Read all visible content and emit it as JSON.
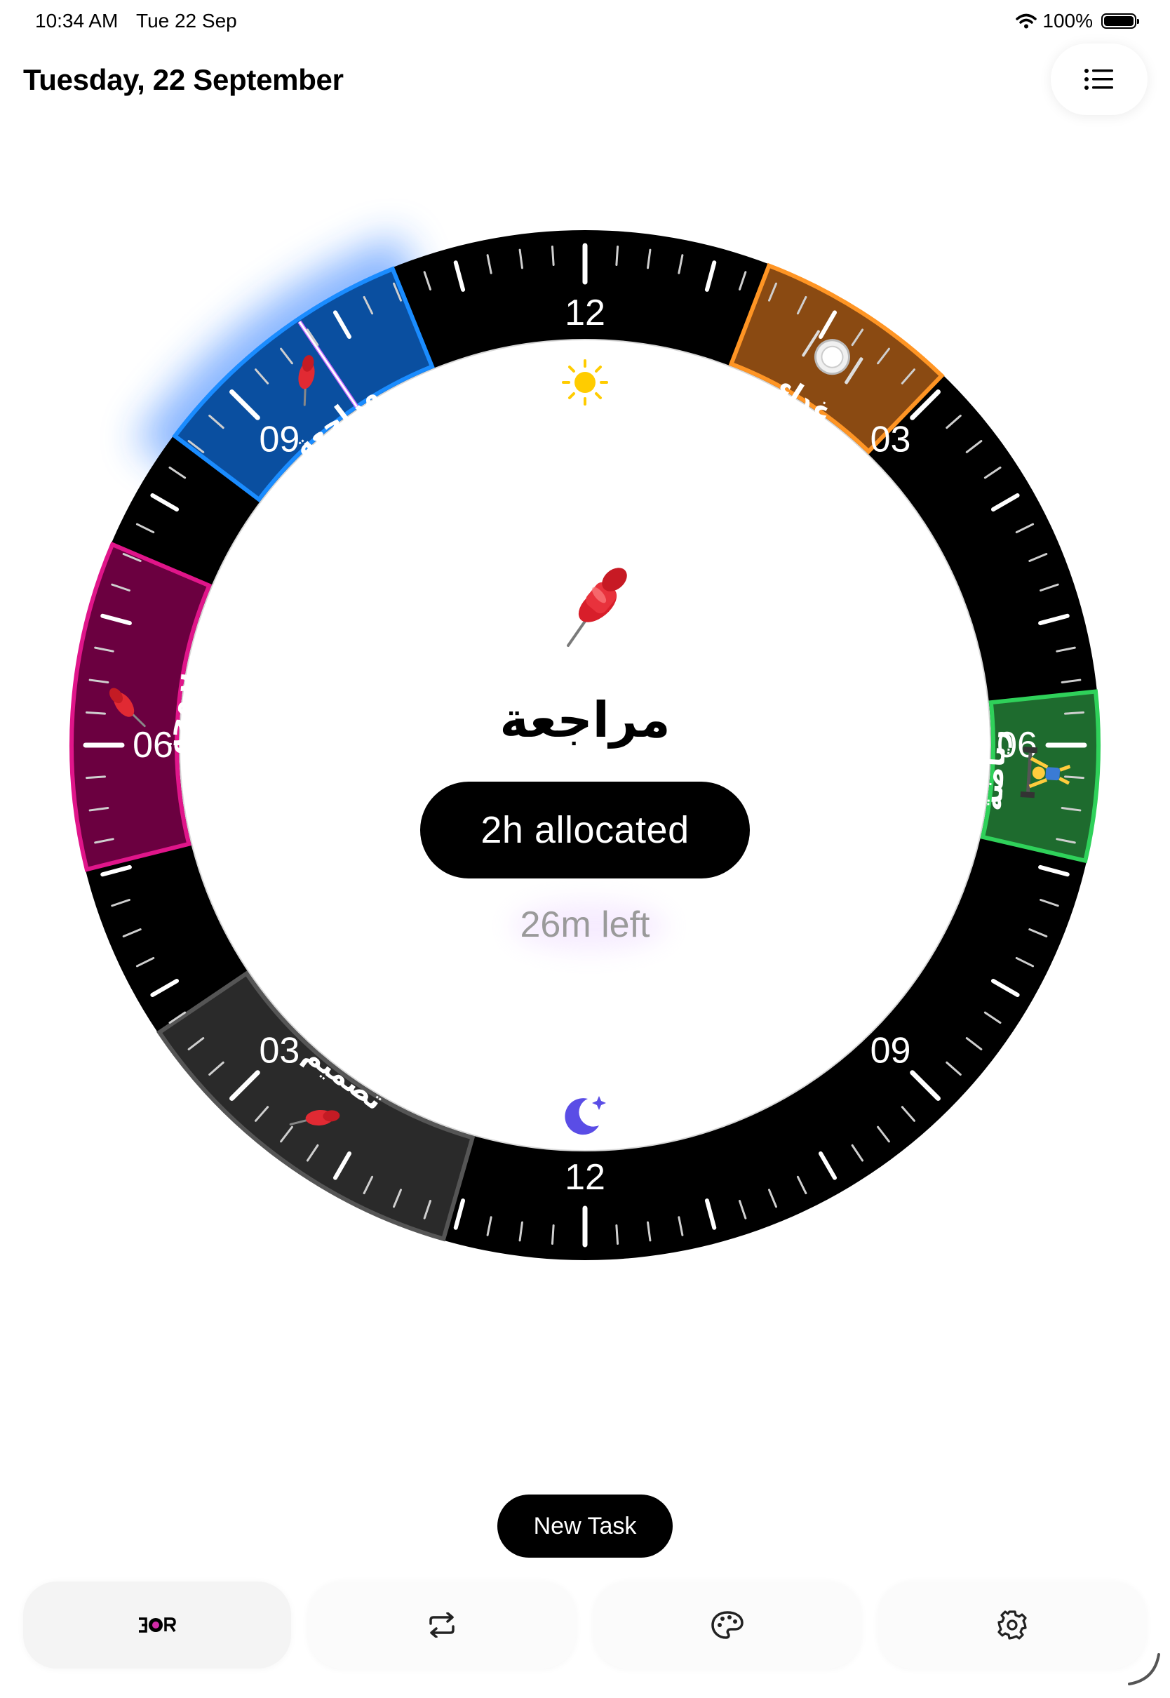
{
  "status_bar": {
    "time": "10:34 AM",
    "date": "Tue 22 Sep",
    "battery": "100%"
  },
  "header": {
    "title": "Tuesday, 22 September",
    "list_button_icon": "list-icon"
  },
  "clock": {
    "hour_labels_top": [
      "12",
      "03",
      "06",
      "09"
    ],
    "hour_labels_bottom": [
      "12",
      "03",
      "06",
      "09"
    ],
    "ring_color": "#000000",
    "day_icon": "sun-icon",
    "night_icon": "moon-stars-icon",
    "tasks": [
      {
        "name": "مراجعة",
        "icon": "pushpin-icon",
        "color": "#0a4fa0",
        "border": "#1a8cff"
      },
      {
        "name": "غداء",
        "icon": "plate-icon",
        "color": "#8a4a12",
        "border": "#ff9524"
      },
      {
        "name": "رياضة",
        "icon": "weightlifter-icon",
        "color": "#1e6b2e",
        "border": "#2fd15a"
      },
      {
        "name": "تصميم",
        "icon": "pushpin-icon",
        "color": "#2a2a2a",
        "border": "#555555"
      },
      {
        "name": "برمجة",
        "icon": "pushpin-icon",
        "color": "#6b0040",
        "border": "#e0158a"
      }
    ],
    "current_task": {
      "icon": "pushpin-icon",
      "name": "مراجعة",
      "allocated": "2h allocated",
      "remaining": "26m left"
    }
  },
  "actions": {
    "new_task": "New Task"
  },
  "tab_bar": {
    "tabs": [
      {
        "name": "tab-clock",
        "icon": "clock-logo-icon",
        "active": true
      },
      {
        "name": "tab-repeat",
        "icon": "repeat-icon",
        "active": false
      },
      {
        "name": "tab-palette",
        "icon": "palette-icon",
        "active": false
      },
      {
        "name": "tab-settings",
        "icon": "gear-icon",
        "active": false
      }
    ]
  }
}
